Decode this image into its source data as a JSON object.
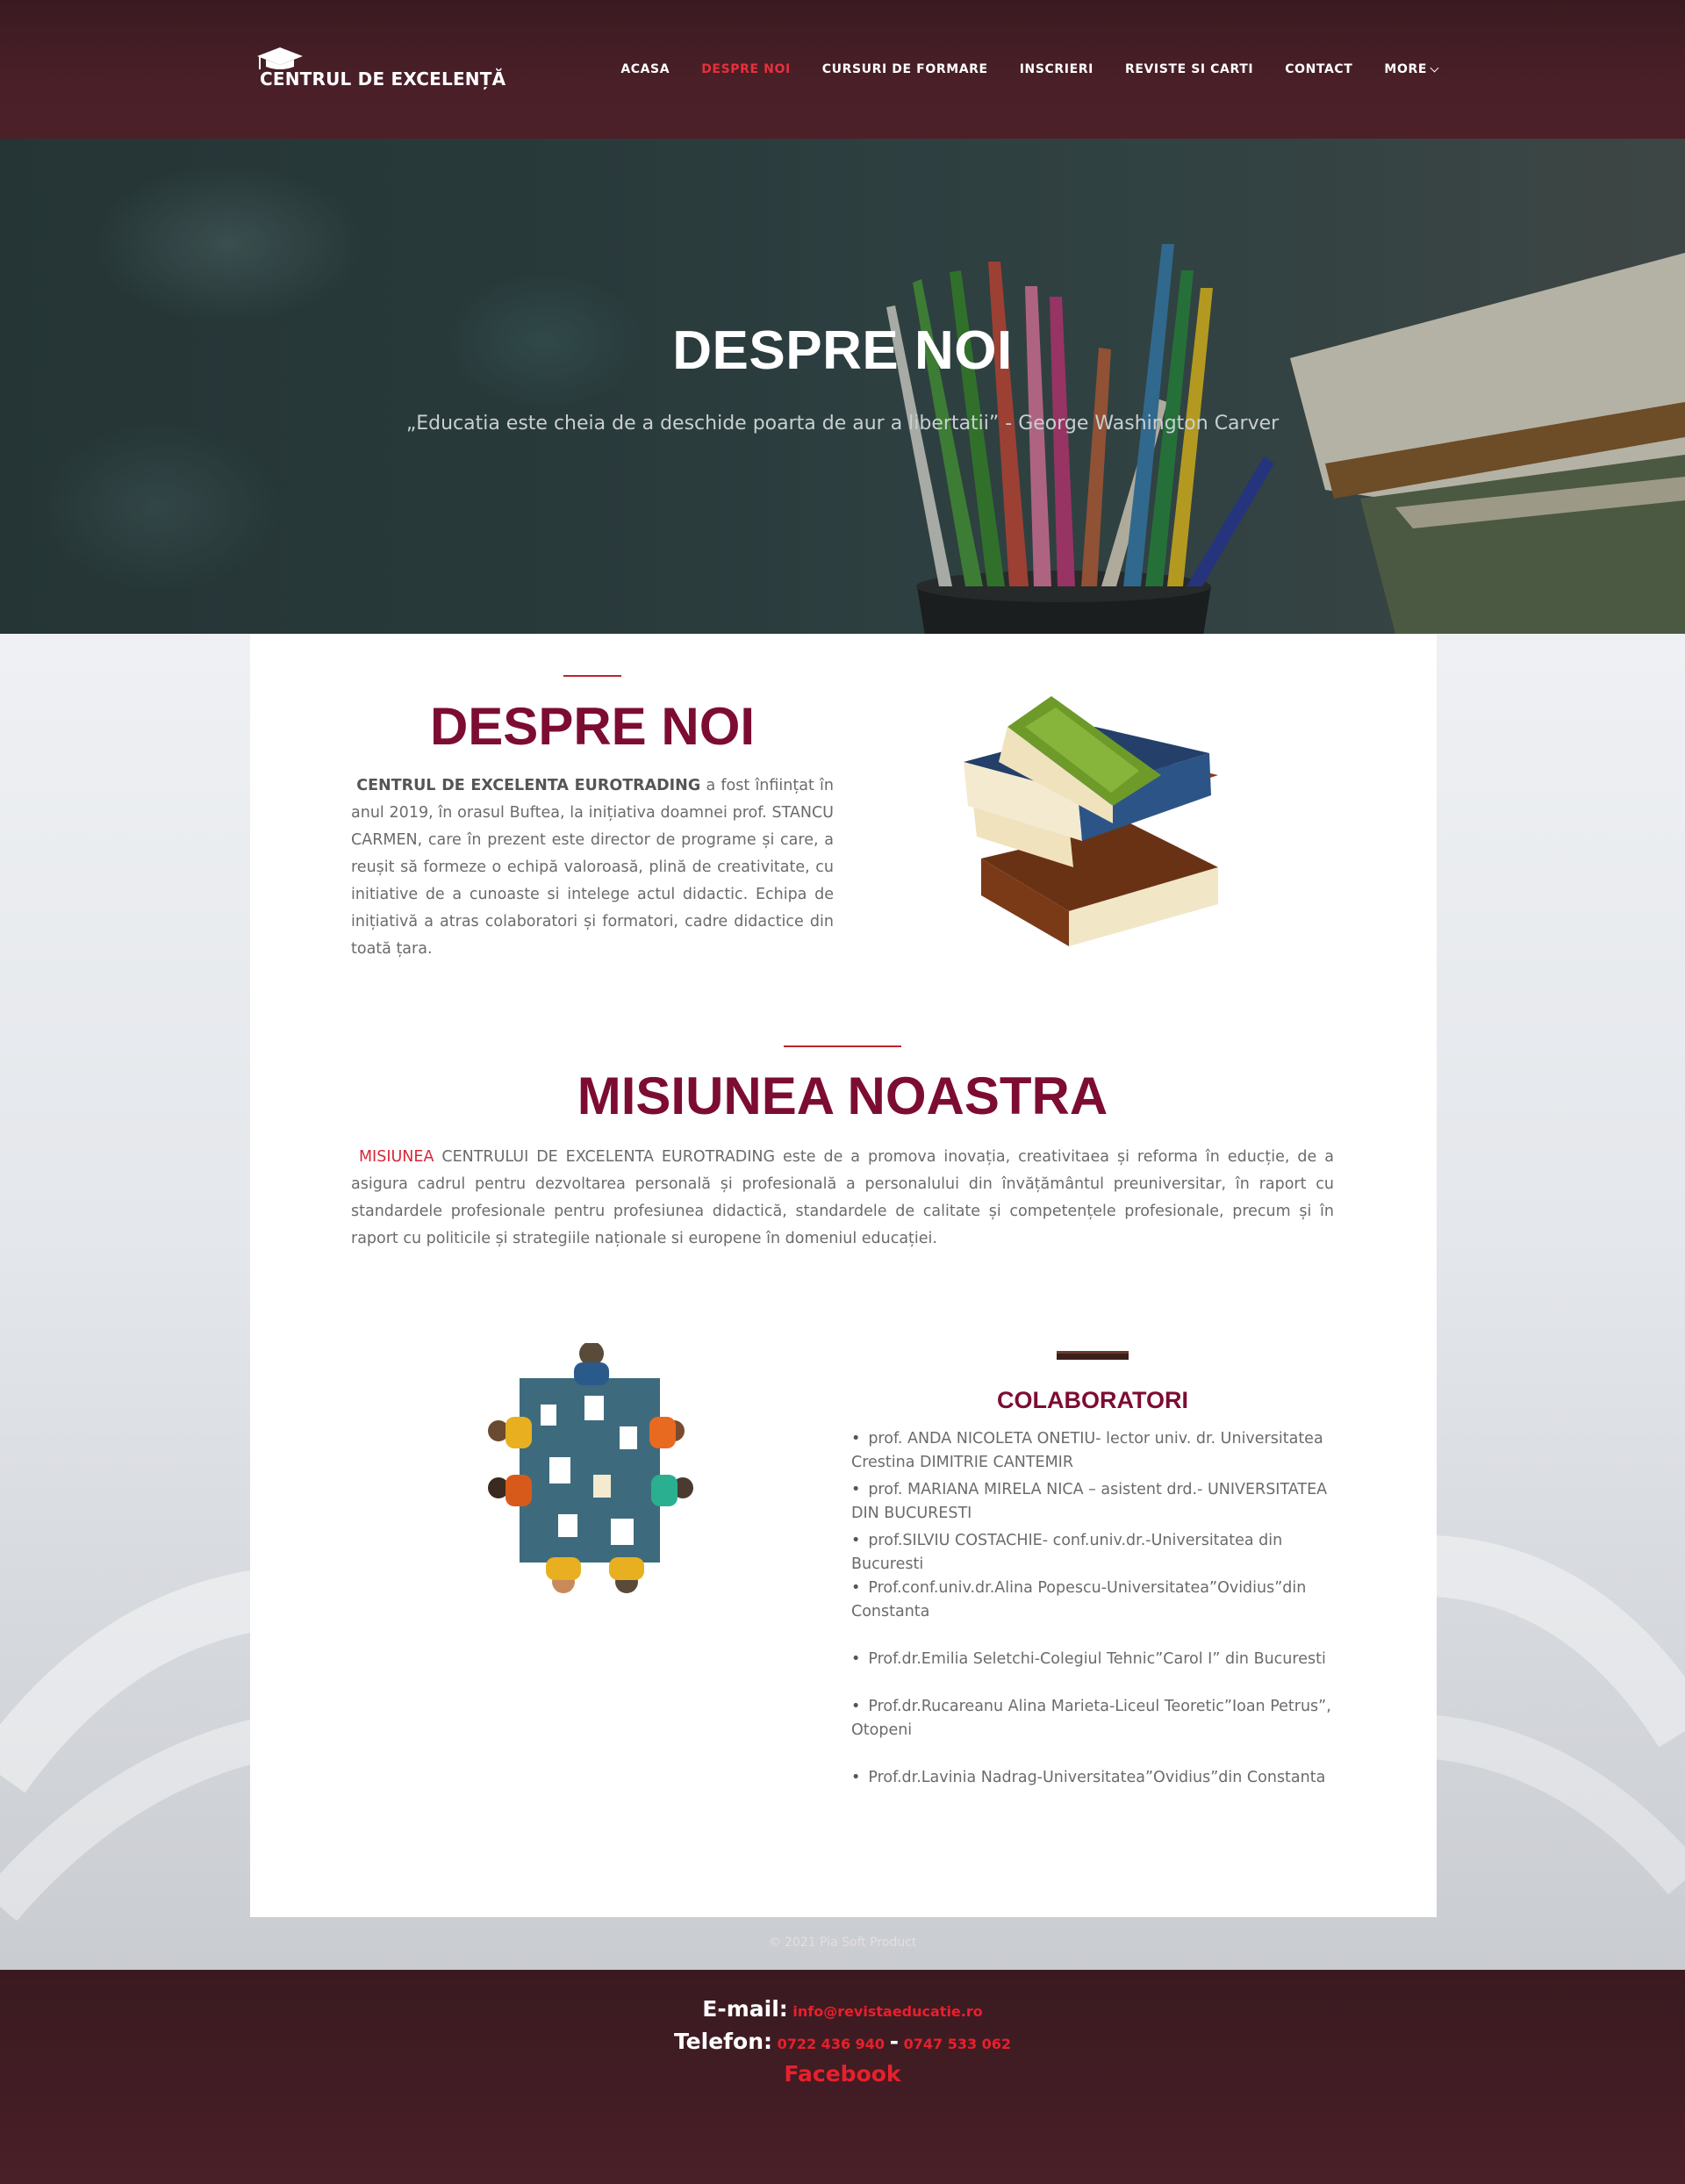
{
  "header": {
    "logo_text": "CENTRUL DE EXCELENȚĂ",
    "nav": [
      {
        "label": "ACASA",
        "active": false
      },
      {
        "label": "DESPRE NOI",
        "active": true
      },
      {
        "label": "CURSURI DE FORMARE",
        "active": false
      },
      {
        "label": "INSCRIERI",
        "active": false
      },
      {
        "label": "REVISTE SI CARTI",
        "active": false
      },
      {
        "label": "CONTACT",
        "active": false
      },
      {
        "label": "MORE",
        "active": false
      }
    ]
  },
  "hero": {
    "title": "DESPRE NOI",
    "quote": "„Educatia este cheia de a deschide poarta de aur a libertatii” - George Washington Carver"
  },
  "about": {
    "title": "DESPRE NOI",
    "strong": "CENTRUL DE EXCELENTA EUROTRADING",
    "text": "a fost înființat în anul 2019, în orasul Buftea, la inițiativa doamnei prof. STANCU CARMEN, care în prezent este director de programe și care, a reușit să formeze o echipă valoroasă, plină de creativitate, cu initiative de a cunoaste si intelege actul didactic. Echipa de inițiativă a atras colaboratori și formatori, cadre didactice din toată țara."
  },
  "mission": {
    "title": "MISIUNEA NOASTRA",
    "highlight": "MISIUNEA",
    "text": "CENTRULUI DE EXCELENTA EUROTRADING este de a promova inovația, creativitaea și reforma în educție, de a asigura cadrul pentru dezvoltarea personală și profesională a personalului din învățământul preuniversitar, în raport cu standardele profesionale pentru profesiunea didactică, standardele de calitate și competențele profesionale, precum și în raport cu politicile și strategiile naționale si europene în domeniul educației."
  },
  "collaborators": {
    "title": "COLABORATORI",
    "items": [
      "prof. ANDA NICOLETA ONETIU- lector univ. dr. Universitatea Crestina DIMITRIE CANTEMIR",
      "prof. MARIANA MIRELA NICA – asistent drd.- UNIVERSITATEA DIN BUCURESTI",
      "prof.SILVIU COSTACHIE- conf.univ.dr.-Universitatea din Bucuresti",
      "Prof.conf.univ.dr.Alina Popescu-Universitatea”Ovidius”din Constanta",
      "Prof.dr.Emilia Seletchi-Colegiul Tehnic”Carol I” din Bucuresti",
      "Prof.dr.Rucareanu Alina Marieta-Liceul Teoretic”Ioan Petrus”, Otopeni",
      "Prof.dr.Lavinia Nadrag-Universitatea”Ovidius”din Constanta"
    ]
  },
  "footer": {
    "email_label": "E-mail:",
    "email": "info@revistaeducatie.ro",
    "phone_label": "Telefon:",
    "phone1": "0722 436 940",
    "phone_sep": "-",
    "phone2": "0747 533 062",
    "facebook": "Facebook",
    "copyright": "© 2021 Pia Soft Product"
  },
  "colors": {
    "brand_dark": "#4a1f28",
    "accent_red": "#e8303c",
    "title_maroon": "#7d0c32"
  }
}
